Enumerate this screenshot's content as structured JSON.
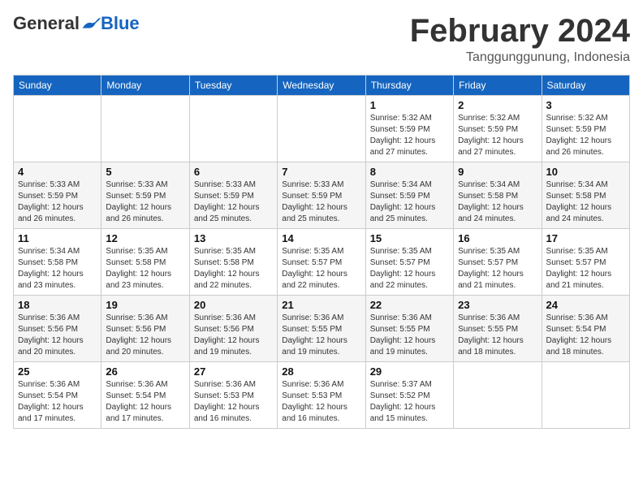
{
  "header": {
    "logo_general": "General",
    "logo_blue": "Blue",
    "month_title": "February 2024",
    "location": "Tanggunggunung, Indonesia"
  },
  "days_of_week": [
    "Sunday",
    "Monday",
    "Tuesday",
    "Wednesday",
    "Thursday",
    "Friday",
    "Saturday"
  ],
  "weeks": [
    [
      {
        "day": "",
        "info": ""
      },
      {
        "day": "",
        "info": ""
      },
      {
        "day": "",
        "info": ""
      },
      {
        "day": "",
        "info": ""
      },
      {
        "day": "1",
        "info": "Sunrise: 5:32 AM\nSunset: 5:59 PM\nDaylight: 12 hours and 27 minutes."
      },
      {
        "day": "2",
        "info": "Sunrise: 5:32 AM\nSunset: 5:59 PM\nDaylight: 12 hours and 27 minutes."
      },
      {
        "day": "3",
        "info": "Sunrise: 5:32 AM\nSunset: 5:59 PM\nDaylight: 12 hours and 26 minutes."
      }
    ],
    [
      {
        "day": "4",
        "info": "Sunrise: 5:33 AM\nSunset: 5:59 PM\nDaylight: 12 hours and 26 minutes."
      },
      {
        "day": "5",
        "info": "Sunrise: 5:33 AM\nSunset: 5:59 PM\nDaylight: 12 hours and 26 minutes."
      },
      {
        "day": "6",
        "info": "Sunrise: 5:33 AM\nSunset: 5:59 PM\nDaylight: 12 hours and 25 minutes."
      },
      {
        "day": "7",
        "info": "Sunrise: 5:33 AM\nSunset: 5:59 PM\nDaylight: 12 hours and 25 minutes."
      },
      {
        "day": "8",
        "info": "Sunrise: 5:34 AM\nSunset: 5:59 PM\nDaylight: 12 hours and 25 minutes."
      },
      {
        "day": "9",
        "info": "Sunrise: 5:34 AM\nSunset: 5:58 PM\nDaylight: 12 hours and 24 minutes."
      },
      {
        "day": "10",
        "info": "Sunrise: 5:34 AM\nSunset: 5:58 PM\nDaylight: 12 hours and 24 minutes."
      }
    ],
    [
      {
        "day": "11",
        "info": "Sunrise: 5:34 AM\nSunset: 5:58 PM\nDaylight: 12 hours and 23 minutes."
      },
      {
        "day": "12",
        "info": "Sunrise: 5:35 AM\nSunset: 5:58 PM\nDaylight: 12 hours and 23 minutes."
      },
      {
        "day": "13",
        "info": "Sunrise: 5:35 AM\nSunset: 5:58 PM\nDaylight: 12 hours and 22 minutes."
      },
      {
        "day": "14",
        "info": "Sunrise: 5:35 AM\nSunset: 5:57 PM\nDaylight: 12 hours and 22 minutes."
      },
      {
        "day": "15",
        "info": "Sunrise: 5:35 AM\nSunset: 5:57 PM\nDaylight: 12 hours and 22 minutes."
      },
      {
        "day": "16",
        "info": "Sunrise: 5:35 AM\nSunset: 5:57 PM\nDaylight: 12 hours and 21 minutes."
      },
      {
        "day": "17",
        "info": "Sunrise: 5:35 AM\nSunset: 5:57 PM\nDaylight: 12 hours and 21 minutes."
      }
    ],
    [
      {
        "day": "18",
        "info": "Sunrise: 5:36 AM\nSunset: 5:56 PM\nDaylight: 12 hours and 20 minutes."
      },
      {
        "day": "19",
        "info": "Sunrise: 5:36 AM\nSunset: 5:56 PM\nDaylight: 12 hours and 20 minutes."
      },
      {
        "day": "20",
        "info": "Sunrise: 5:36 AM\nSunset: 5:56 PM\nDaylight: 12 hours and 19 minutes."
      },
      {
        "day": "21",
        "info": "Sunrise: 5:36 AM\nSunset: 5:55 PM\nDaylight: 12 hours and 19 minutes."
      },
      {
        "day": "22",
        "info": "Sunrise: 5:36 AM\nSunset: 5:55 PM\nDaylight: 12 hours and 19 minutes."
      },
      {
        "day": "23",
        "info": "Sunrise: 5:36 AM\nSunset: 5:55 PM\nDaylight: 12 hours and 18 minutes."
      },
      {
        "day": "24",
        "info": "Sunrise: 5:36 AM\nSunset: 5:54 PM\nDaylight: 12 hours and 18 minutes."
      }
    ],
    [
      {
        "day": "25",
        "info": "Sunrise: 5:36 AM\nSunset: 5:54 PM\nDaylight: 12 hours and 17 minutes."
      },
      {
        "day": "26",
        "info": "Sunrise: 5:36 AM\nSunset: 5:54 PM\nDaylight: 12 hours and 17 minutes."
      },
      {
        "day": "27",
        "info": "Sunrise: 5:36 AM\nSunset: 5:53 PM\nDaylight: 12 hours and 16 minutes."
      },
      {
        "day": "28",
        "info": "Sunrise: 5:36 AM\nSunset: 5:53 PM\nDaylight: 12 hours and 16 minutes."
      },
      {
        "day": "29",
        "info": "Sunrise: 5:37 AM\nSunset: 5:52 PM\nDaylight: 12 hours and 15 minutes."
      },
      {
        "day": "",
        "info": ""
      },
      {
        "day": "",
        "info": ""
      }
    ]
  ]
}
